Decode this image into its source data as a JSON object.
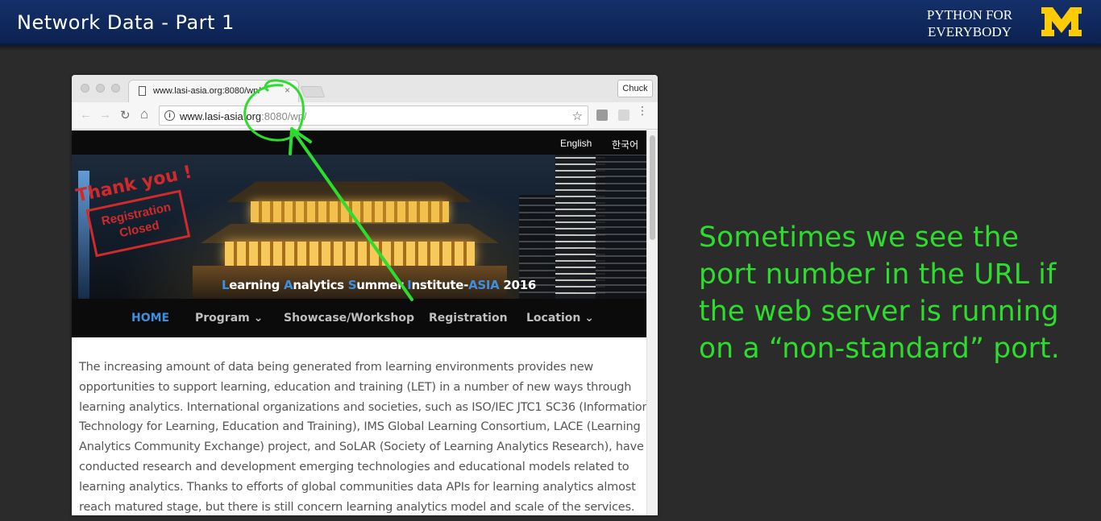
{
  "slide": {
    "title": "Network Data - Part 1",
    "brand_line1": "PYTHON FOR",
    "brand_line2": "EVERYBODY",
    "logo_letter": "M",
    "note_lines": [
      "Sometimes we see the",
      "port number in the URL if",
      "the web server is running",
      "on a “non-standard” port."
    ]
  },
  "browser": {
    "tab_title": "www.lasi-asia.org:8080/wp/",
    "tab_close": "×",
    "profile_button": "Chuck",
    "url_host": "www.lasi-asia.org",
    "url_rest": ":8080/wp/",
    "back_icon": "←",
    "forward_icon": "→",
    "reload_icon": "↻",
    "home_icon": "⌂",
    "info_icon": "i",
    "star_icon": "☆",
    "menu_icon": "⋮"
  },
  "page": {
    "lang_english": "English",
    "lang_korean": "한국어",
    "stamp_thanks": "Thank you !",
    "stamp_line1": "Registration",
    "stamp_line2": "Closed",
    "hero_caption": {
      "L": "L",
      "earning": "earning ",
      "A1": "A",
      "nalytics": "nalytics ",
      "S": "S",
      "ummer": "ummer ",
      "I": "I",
      "nstitute": "nstitute-",
      "ASIA": "ASIA",
      "year": " 2016"
    },
    "nav": {
      "home": "HOME",
      "program": "Program ⌄",
      "showcase": "Showcase/Workshop",
      "registration": "Registration",
      "location": "Location ⌄"
    },
    "article_lines": [
      "The increasing amount of data being generated from learning environments provides new",
      "opportunities to support learning, education and training (LET) in a number of new ways through",
      "learning analytics. International organizations and societies, such as ISO/IEC JTC1 SC36 (Information",
      "Technology for Learning, Education and Training), IMS Global Learning Consortium, LACE (Learning",
      "Analytics Community Exchange) project, and SoLAR (Society of Learning Analytics Research), have",
      "conducted research and development emerging technologies and educational models related to",
      "learning analytics. Thanks to efforts of global communities data APIs for learning analytics almost",
      "reach matured stage, but there is still concern learning analytics model and scale of the services."
    ]
  },
  "colors": {
    "annotation": "#2edc2e",
    "nav_active": "#3d8fe0",
    "stamp": "#d22a2a",
    "title_bar": "#14306a",
    "logo_yellow": "#ffcb05"
  }
}
